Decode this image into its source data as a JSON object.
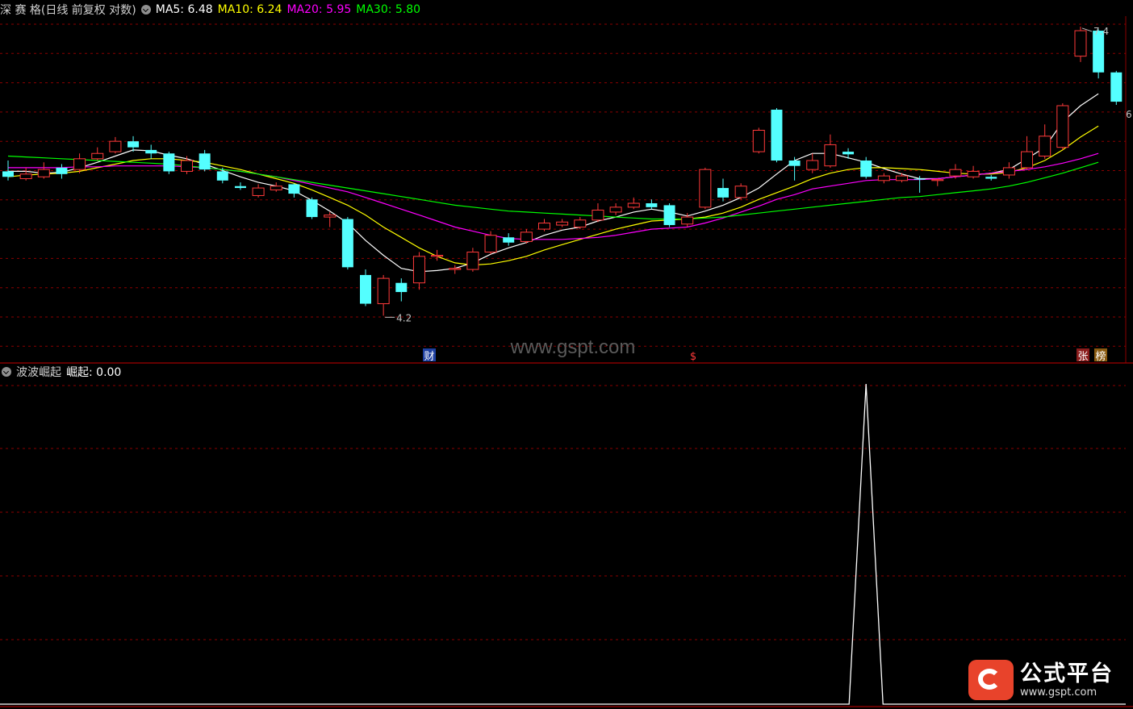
{
  "header": {
    "title": "深 赛 格(日线 前复权 对数)",
    "ma5": "MA5: 6.48",
    "ma10": "MA10: 6.24",
    "ma20": "MA20: 5.95",
    "ma30": "MA30: 5.80"
  },
  "indicator": {
    "name": "波波崛起",
    "value_text": "崛起: 0.00"
  },
  "watermark": "www.gspt.com",
  "logo": {
    "name": "公式平台",
    "url": "www.gspt.com"
  },
  "colors": {
    "up": "#ff3a3a",
    "down": "#54ffff",
    "ma5": "#ffffff",
    "ma10": "#ffff00",
    "ma20": "#ff00ff",
    "ma30": "#00ff00",
    "grid": "#8b0000",
    "indicator": "#ffffff"
  },
  "chart_data": [
    {
      "type": "candlestick",
      "title": "深 赛 格",
      "scale": "log",
      "ylim": [
        3.95,
        7.55
      ],
      "grid": true,
      "annotations": {
        "low": "4.2",
        "high": "7.4",
        "right_mid": "6",
        "markers": [
          "财",
          "$",
          "张",
          "榜"
        ]
      },
      "candles": [
        {
          "o": 5.58,
          "c": 5.52,
          "h": 5.7,
          "l": 5.48
        },
        {
          "o": 5.5,
          "c": 5.55,
          "h": 5.62,
          "l": 5.48
        },
        {
          "o": 5.52,
          "c": 5.6,
          "h": 5.68,
          "l": 5.5
        },
        {
          "o": 5.62,
          "c": 5.55,
          "h": 5.66,
          "l": 5.5
        },
        {
          "o": 5.6,
          "c": 5.72,
          "h": 5.78,
          "l": 5.56
        },
        {
          "o": 5.72,
          "c": 5.78,
          "h": 5.85,
          "l": 5.7
        },
        {
          "o": 5.8,
          "c": 5.92,
          "h": 5.97,
          "l": 5.78
        },
        {
          "o": 5.92,
          "c": 5.85,
          "h": 5.98,
          "l": 5.8
        },
        {
          "o": 5.82,
          "c": 5.78,
          "h": 5.88,
          "l": 5.72
        },
        {
          "o": 5.78,
          "c": 5.58,
          "h": 5.8,
          "l": 5.55
        },
        {
          "o": 5.58,
          "c": 5.7,
          "h": 5.75,
          "l": 5.55
        },
        {
          "o": 5.78,
          "c": 5.6,
          "h": 5.82,
          "l": 5.58
        },
        {
          "o": 5.58,
          "c": 5.48,
          "h": 5.62,
          "l": 5.45
        },
        {
          "o": 5.42,
          "c": 5.4,
          "h": 5.46,
          "l": 5.38
        },
        {
          "o": 5.32,
          "c": 5.4,
          "h": 5.44,
          "l": 5.3
        },
        {
          "o": 5.38,
          "c": 5.42,
          "h": 5.46,
          "l": 5.36
        },
        {
          "o": 5.44,
          "c": 5.34,
          "h": 5.45,
          "l": 5.3
        },
        {
          "o": 5.28,
          "c": 5.1,
          "h": 5.3,
          "l": 5.08
        },
        {
          "o": 5.1,
          "c": 5.12,
          "h": 5.15,
          "l": 5.0
        },
        {
          "o": 5.08,
          "c": 4.62,
          "h": 5.1,
          "l": 4.6
        },
        {
          "o": 4.55,
          "c": 4.3,
          "h": 4.6,
          "l": 4.28
        },
        {
          "o": 4.3,
          "c": 4.52,
          "h": 4.55,
          "l": 4.2
        },
        {
          "o": 4.48,
          "c": 4.4,
          "h": 4.52,
          "l": 4.32
        },
        {
          "o": 4.48,
          "c": 4.72,
          "h": 4.76,
          "l": 4.42
        },
        {
          "o": 4.72,
          "c": 4.73,
          "h": 4.78,
          "l": 4.68
        },
        {
          "o": 4.6,
          "c": 4.61,
          "h": 4.64,
          "l": 4.56
        },
        {
          "o": 4.6,
          "c": 4.76,
          "h": 4.8,
          "l": 4.58
        },
        {
          "o": 4.76,
          "c": 4.92,
          "h": 4.96,
          "l": 4.74
        },
        {
          "o": 4.9,
          "c": 4.85,
          "h": 4.94,
          "l": 4.82
        },
        {
          "o": 4.86,
          "c": 4.95,
          "h": 4.98,
          "l": 4.84
        },
        {
          "o": 4.98,
          "c": 5.04,
          "h": 5.08,
          "l": 4.96
        },
        {
          "o": 5.02,
          "c": 5.05,
          "h": 5.08,
          "l": 5.0
        },
        {
          "o": 5.0,
          "c": 5.07,
          "h": 5.1,
          "l": 4.98
        },
        {
          "o": 5.07,
          "c": 5.17,
          "h": 5.24,
          "l": 5.05
        },
        {
          "o": 5.15,
          "c": 5.2,
          "h": 5.24,
          "l": 5.12
        },
        {
          "o": 5.2,
          "c": 5.24,
          "h": 5.3,
          "l": 5.18
        },
        {
          "o": 5.24,
          "c": 5.2,
          "h": 5.28,
          "l": 5.18
        },
        {
          "o": 5.22,
          "c": 5.02,
          "h": 5.24,
          "l": 5.0
        },
        {
          "o": 5.03,
          "c": 5.1,
          "h": 5.14,
          "l": 5.0
        },
        {
          "o": 5.2,
          "c": 5.6,
          "h": 5.62,
          "l": 5.18
        },
        {
          "o": 5.4,
          "c": 5.3,
          "h": 5.5,
          "l": 5.26
        },
        {
          "o": 5.3,
          "c": 5.42,
          "h": 5.45,
          "l": 5.28
        },
        {
          "o": 5.8,
          "c": 6.05,
          "h": 6.08,
          "l": 5.78
        },
        {
          "o": 6.3,
          "c": 5.7,
          "h": 6.32,
          "l": 5.68
        },
        {
          "o": 5.7,
          "c": 5.64,
          "h": 5.74,
          "l": 5.48
        },
        {
          "o": 5.6,
          "c": 5.7,
          "h": 5.78,
          "l": 5.56
        },
        {
          "o": 5.64,
          "c": 5.88,
          "h": 6.0,
          "l": 5.62
        },
        {
          "o": 5.8,
          "c": 5.77,
          "h": 5.84,
          "l": 5.72
        },
        {
          "o": 5.7,
          "c": 5.52,
          "h": 5.74,
          "l": 5.5
        },
        {
          "o": 5.48,
          "c": 5.53,
          "h": 5.56,
          "l": 5.45
        },
        {
          "o": 5.48,
          "c": 5.53,
          "h": 5.56,
          "l": 5.46
        },
        {
          "o": 5.5,
          "c": 5.49,
          "h": 5.53,
          "l": 5.35
        },
        {
          "o": 5.48,
          "c": 5.49,
          "h": 5.5,
          "l": 5.42
        },
        {
          "o": 5.53,
          "c": 5.6,
          "h": 5.66,
          "l": 5.5
        },
        {
          "o": 5.52,
          "c": 5.58,
          "h": 5.64,
          "l": 5.5
        },
        {
          "o": 5.52,
          "c": 5.5,
          "h": 5.54,
          "l": 5.48
        },
        {
          "o": 5.54,
          "c": 5.62,
          "h": 5.68,
          "l": 5.5
        },
        {
          "o": 5.62,
          "c": 5.8,
          "h": 5.98,
          "l": 5.6
        },
        {
          "o": 5.75,
          "c": 5.98,
          "h": 6.12,
          "l": 5.72
        },
        {
          "o": 5.85,
          "c": 6.35,
          "h": 6.38,
          "l": 5.82
        },
        {
          "o": 7.0,
          "c": 7.36,
          "h": 7.42,
          "l": 6.92
        },
        {
          "o": 7.36,
          "c": 6.78,
          "h": 7.38,
          "l": 6.7
        },
        {
          "o": 6.78,
          "c": 6.4,
          "h": 6.8,
          "l": 6.36
        }
      ],
      "series": [
        {
          "name": "MA5",
          "values": [
            5.58,
            5.58,
            5.56,
            5.57,
            5.62,
            5.68,
            5.75,
            5.82,
            5.81,
            5.76,
            5.72,
            5.66,
            5.59,
            5.52,
            5.46,
            5.42,
            5.37,
            5.27,
            5.16,
            5.04,
            4.87,
            4.73,
            4.61,
            4.58,
            4.59,
            4.61,
            4.66,
            4.74,
            4.8,
            4.85,
            4.92,
            4.97,
            5.0,
            5.06,
            5.1,
            5.15,
            5.18,
            5.15,
            5.11,
            5.16,
            5.22,
            5.3,
            5.4,
            5.55,
            5.7,
            5.78,
            5.78,
            5.73,
            5.68,
            5.61,
            5.55,
            5.5,
            5.5,
            5.52,
            5.54,
            5.56,
            5.6,
            5.72,
            5.85,
            6.15,
            6.35,
            6.5
          ]
        },
        {
          "name": "MA10",
          "values": [
            5.52,
            5.54,
            5.55,
            5.56,
            5.58,
            5.62,
            5.66,
            5.7,
            5.72,
            5.72,
            5.7,
            5.68,
            5.64,
            5.6,
            5.55,
            5.5,
            5.45,
            5.38,
            5.3,
            5.22,
            5.12,
            5.0,
            4.9,
            4.8,
            4.72,
            4.66,
            4.64,
            4.65,
            4.68,
            4.72,
            4.78,
            4.83,
            4.88,
            4.93,
            4.98,
            5.02,
            5.06,
            5.07,
            5.08,
            5.1,
            5.14,
            5.2,
            5.28,
            5.35,
            5.42,
            5.5,
            5.56,
            5.6,
            5.62,
            5.62,
            5.61,
            5.6,
            5.58,
            5.56,
            5.55,
            5.55,
            5.57,
            5.62,
            5.7,
            5.82,
            5.97,
            6.1
          ]
        },
        {
          "name": "MA20",
          "values": [
            5.62,
            5.62,
            5.62,
            5.62,
            5.63,
            5.63,
            5.64,
            5.64,
            5.64,
            5.64,
            5.63,
            5.62,
            5.6,
            5.58,
            5.55,
            5.52,
            5.48,
            5.44,
            5.4,
            5.36,
            5.3,
            5.24,
            5.18,
            5.12,
            5.06,
            5.0,
            4.96,
            4.92,
            4.89,
            4.88,
            4.88,
            4.88,
            4.89,
            4.9,
            4.92,
            4.95,
            4.98,
            4.99,
            5.0,
            5.04,
            5.09,
            5.15,
            5.21,
            5.28,
            5.33,
            5.39,
            5.42,
            5.45,
            5.48,
            5.49,
            5.49,
            5.49,
            5.5,
            5.52,
            5.54,
            5.56,
            5.58,
            5.6,
            5.63,
            5.67,
            5.72,
            5.78
          ]
        },
        {
          "name": "MA30",
          "values": [
            5.75,
            5.74,
            5.73,
            5.72,
            5.71,
            5.7,
            5.69,
            5.68,
            5.67,
            5.66,
            5.64,
            5.62,
            5.6,
            5.58,
            5.55,
            5.52,
            5.49,
            5.46,
            5.43,
            5.4,
            5.37,
            5.34,
            5.31,
            5.28,
            5.25,
            5.22,
            5.2,
            5.18,
            5.16,
            5.15,
            5.14,
            5.13,
            5.12,
            5.11,
            5.1,
            5.09,
            5.08,
            5.08,
            5.08,
            5.09,
            5.1,
            5.12,
            5.14,
            5.16,
            5.18,
            5.2,
            5.22,
            5.24,
            5.26,
            5.28,
            5.3,
            5.31,
            5.33,
            5.35,
            5.37,
            5.39,
            5.42,
            5.46,
            5.51,
            5.56,
            5.62,
            5.68
          ]
        }
      ]
    },
    {
      "type": "line",
      "title": "波波崛起",
      "series": [
        {
          "name": "崛起",
          "values": [
            0,
            0,
            0,
            0,
            0,
            0,
            0,
            0,
            0,
            0,
            0,
            0,
            0,
            0,
            0,
            0,
            0,
            0,
            0,
            0,
            0,
            0,
            0,
            0,
            0,
            0,
            0,
            0,
            0,
            0,
            0,
            0,
            0,
            0,
            0,
            0,
            0,
            0,
            0,
            0,
            0,
            0,
            0,
            0,
            0,
            0,
            0,
            0,
            1,
            0,
            0,
            0,
            0,
            0,
            0,
            0,
            0,
            0,
            0,
            0,
            0,
            0
          ]
        }
      ],
      "ylim": [
        0,
        1
      ],
      "grid": true
    }
  ]
}
